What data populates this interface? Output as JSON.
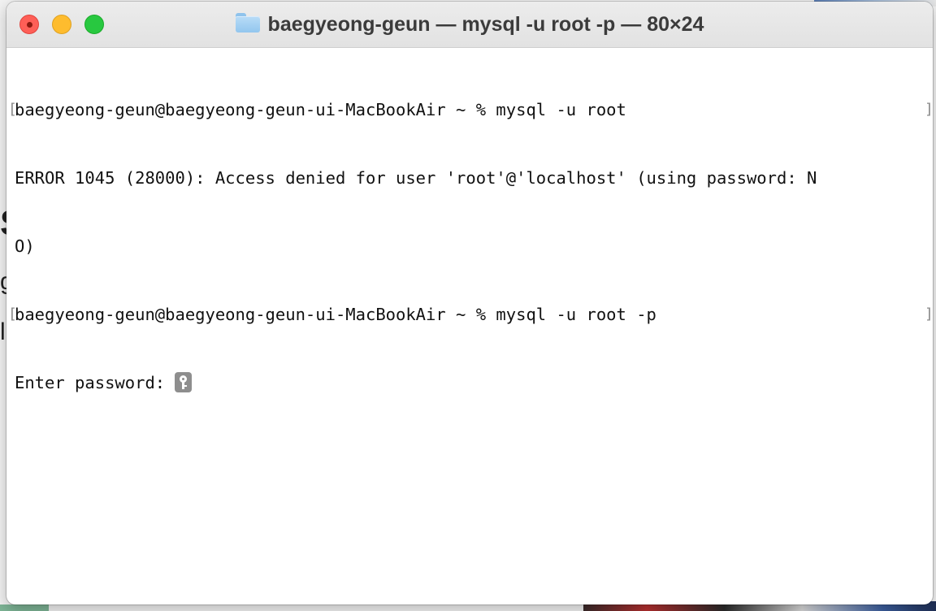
{
  "window": {
    "title": "baegyeong-geun — mysql -u root -p — 80×24",
    "folder_icon": "folder-icon"
  },
  "terminal": {
    "lines": [
      "baegyeong-geun@baegyeong-geun-ui-MacBookAir ~ % mysql -u root",
      "ERROR 1045 (28000): Access denied for user 'root'@'localhost' (using password: N",
      "O)",
      "baegyeong-geun@baegyeong-geun-ui-MacBookAir ~ % mysql -u root -p",
      "Enter password: "
    ],
    "secure_input_icon": "key-icon"
  },
  "background": {
    "partial_glyphs": [
      "S",
      "g",
      "l"
    ]
  },
  "colors": {
    "close": "#fe5f57",
    "minimize": "#febc2e",
    "maximize": "#28c840",
    "text": "#111111",
    "title": "#3b3b3b"
  }
}
